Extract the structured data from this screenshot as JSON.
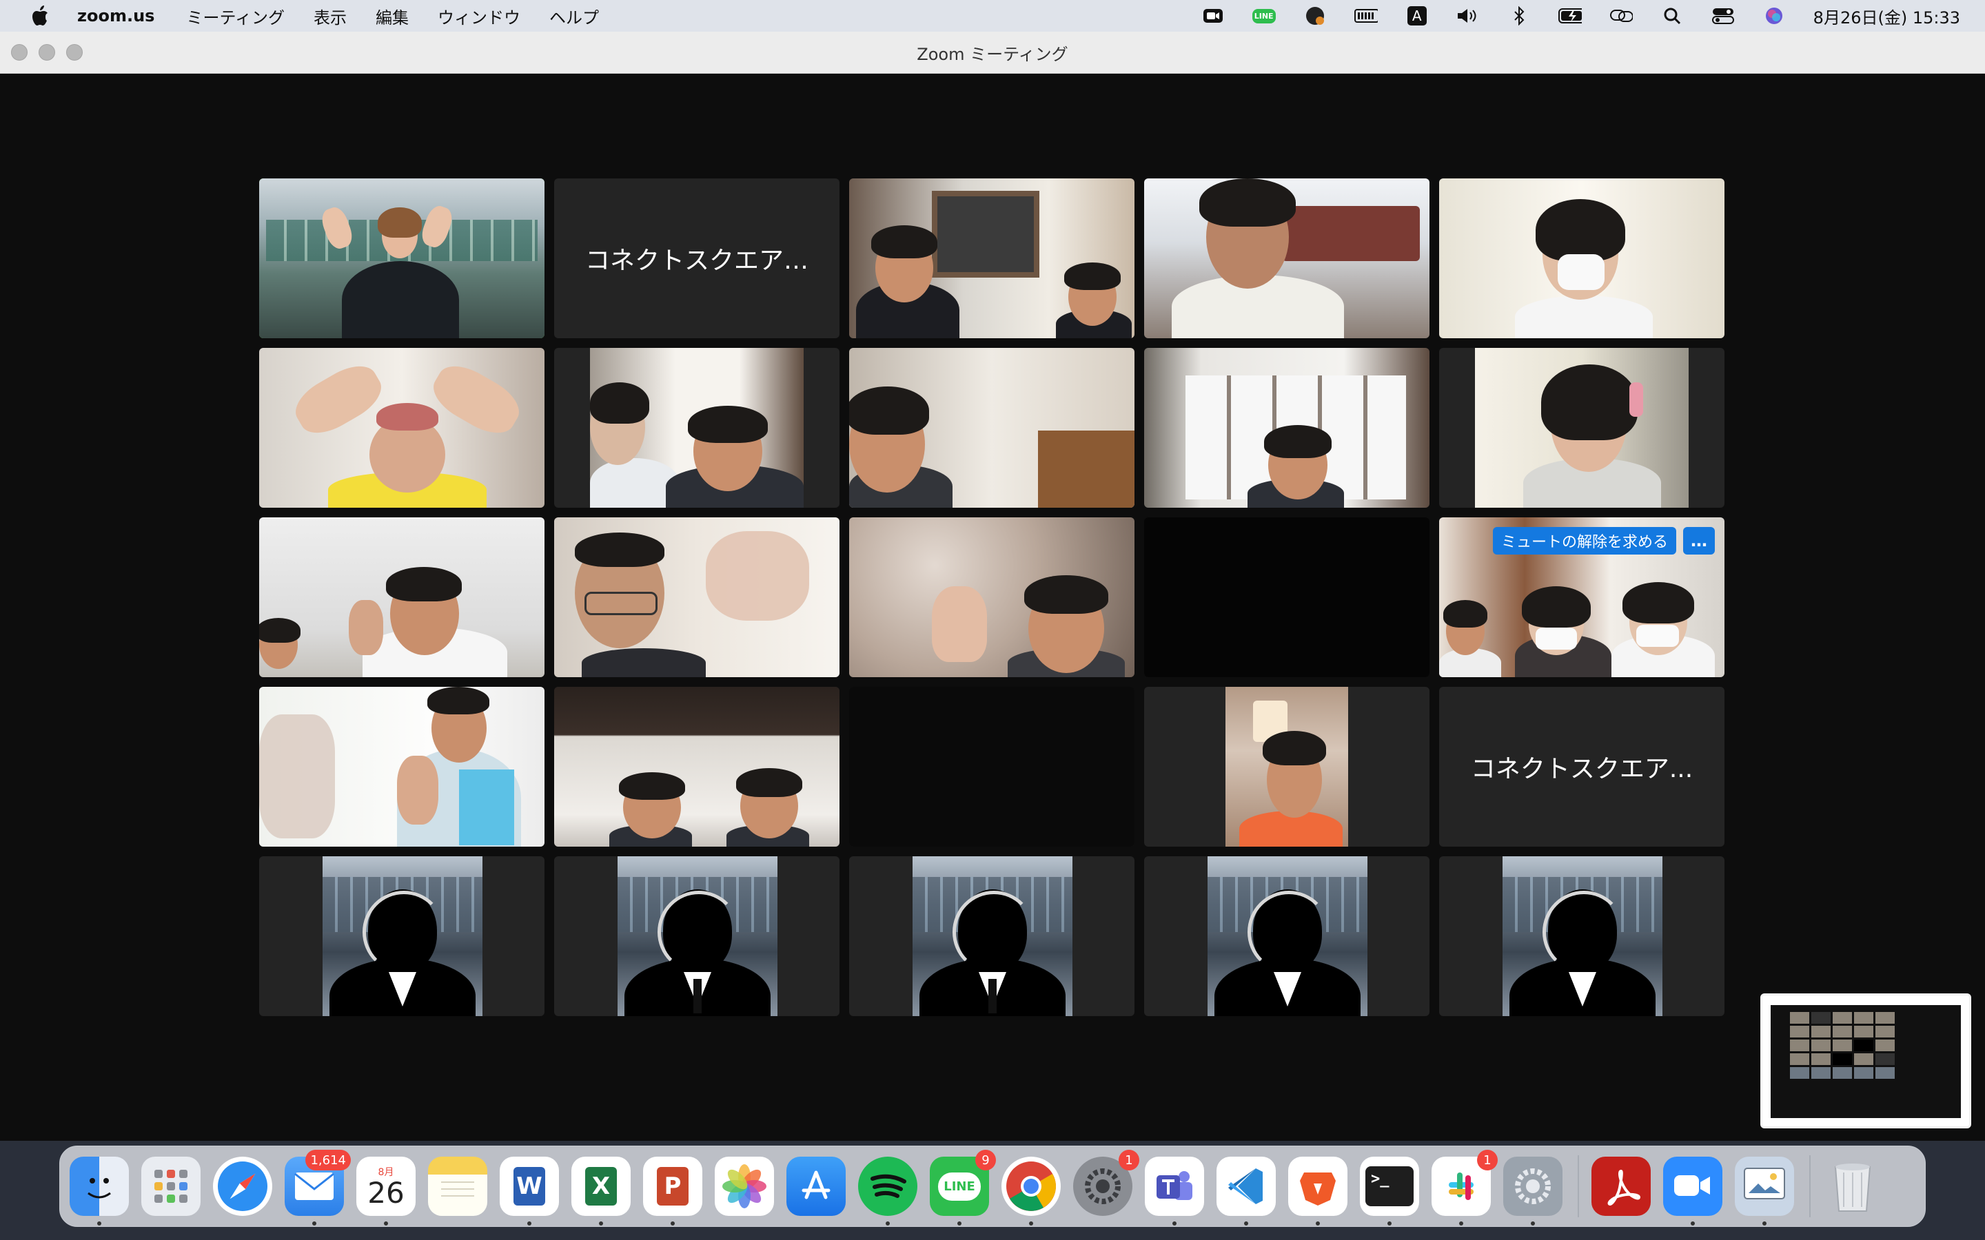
{
  "menubar": {
    "app_name": "zoom.us",
    "menus": [
      "ミーティング",
      "表示",
      "編集",
      "ウィンドウ",
      "ヘルプ"
    ],
    "status_icons": [
      "zoom-icon",
      "line-icon",
      "agent-icon",
      "battery-meter-icon",
      "input-source-icon",
      "volume-icon",
      "bluetooth-icon",
      "battery-icon",
      "screen-mirroring-icon",
      "search-icon",
      "control-center-icon",
      "siri-icon"
    ],
    "input_source_label": "A",
    "line_label": "LINE",
    "clock": "8月26日(金)  15:33"
  },
  "window": {
    "title": "Zoom ミーティング"
  },
  "gallery": {
    "tiles": [
      {
        "kind": "video",
        "name": "speaker"
      },
      {
        "kind": "name",
        "label": "コネクトスクエア…"
      },
      {
        "kind": "video"
      },
      {
        "kind": "video"
      },
      {
        "kind": "video"
      },
      {
        "kind": "video"
      },
      {
        "kind": "video"
      },
      {
        "kind": "video"
      },
      {
        "kind": "video"
      },
      {
        "kind": "video"
      },
      {
        "kind": "video"
      },
      {
        "kind": "video"
      },
      {
        "kind": "video"
      },
      {
        "kind": "black"
      },
      {
        "kind": "video",
        "unmute": true
      },
      {
        "kind": "video"
      },
      {
        "kind": "video"
      },
      {
        "kind": "black"
      },
      {
        "kind": "video"
      },
      {
        "kind": "name",
        "label": "コネクトスクエア..."
      },
      {
        "kind": "avatar",
        "avatar": "female"
      },
      {
        "kind": "avatar",
        "avatar": "male"
      },
      {
        "kind": "avatar",
        "avatar": "male"
      },
      {
        "kind": "avatar",
        "avatar": "female"
      },
      {
        "kind": "avatar",
        "avatar": "female"
      }
    ],
    "unmute_request_label": "ミュートの解除を求める",
    "more_label": "…"
  },
  "dock": {
    "apps": [
      {
        "name": "finder",
        "color": "#3b8ff0"
      },
      {
        "name": "launchpad",
        "color": "#e9ecf1"
      },
      {
        "name": "safari",
        "color": "#2c8ff2"
      },
      {
        "name": "mail",
        "color": "#3a8ef5",
        "badge": "1,614"
      },
      {
        "name": "calendar",
        "color": "#ffffff",
        "month": "8月",
        "day": "26"
      },
      {
        "name": "notes",
        "color": "#f7d155"
      },
      {
        "name": "word",
        "color": "#2b5fb3",
        "letter": "W"
      },
      {
        "name": "excel",
        "color": "#1f7a44",
        "letter": "X"
      },
      {
        "name": "powerpoint",
        "color": "#c8472b",
        "letter": "P"
      },
      {
        "name": "photos",
        "color": "#f1f1f1"
      },
      {
        "name": "app-store",
        "color": "#2e86f0"
      },
      {
        "name": "spotify",
        "color": "#1db954"
      },
      {
        "name": "line",
        "color": "#2ebd4e",
        "letter": "LINE",
        "badge": "9"
      },
      {
        "name": "chrome",
        "color": "#ffffff"
      },
      {
        "name": "system-preferences-old",
        "color": "#8a8d93",
        "badge": "1"
      },
      {
        "name": "teams",
        "color": "#5a62c8"
      },
      {
        "name": "vscode",
        "color": "#2a8ad8"
      },
      {
        "name": "brave",
        "color": "#f05a28"
      },
      {
        "name": "terminal",
        "color": "#1e1e1e",
        "letter": ">_"
      },
      {
        "name": "slack",
        "color": "#ffffff",
        "badge": "1"
      },
      {
        "name": "system-preferences",
        "color": "#9aa3ad"
      },
      {
        "name": "acrobat",
        "color": "#c4201b"
      },
      {
        "name": "zoom",
        "color": "#2d8cff"
      },
      {
        "name": "preview",
        "color": "#c9d6e6"
      },
      {
        "name": "trash",
        "color": "#e7e9ec"
      }
    ]
  }
}
